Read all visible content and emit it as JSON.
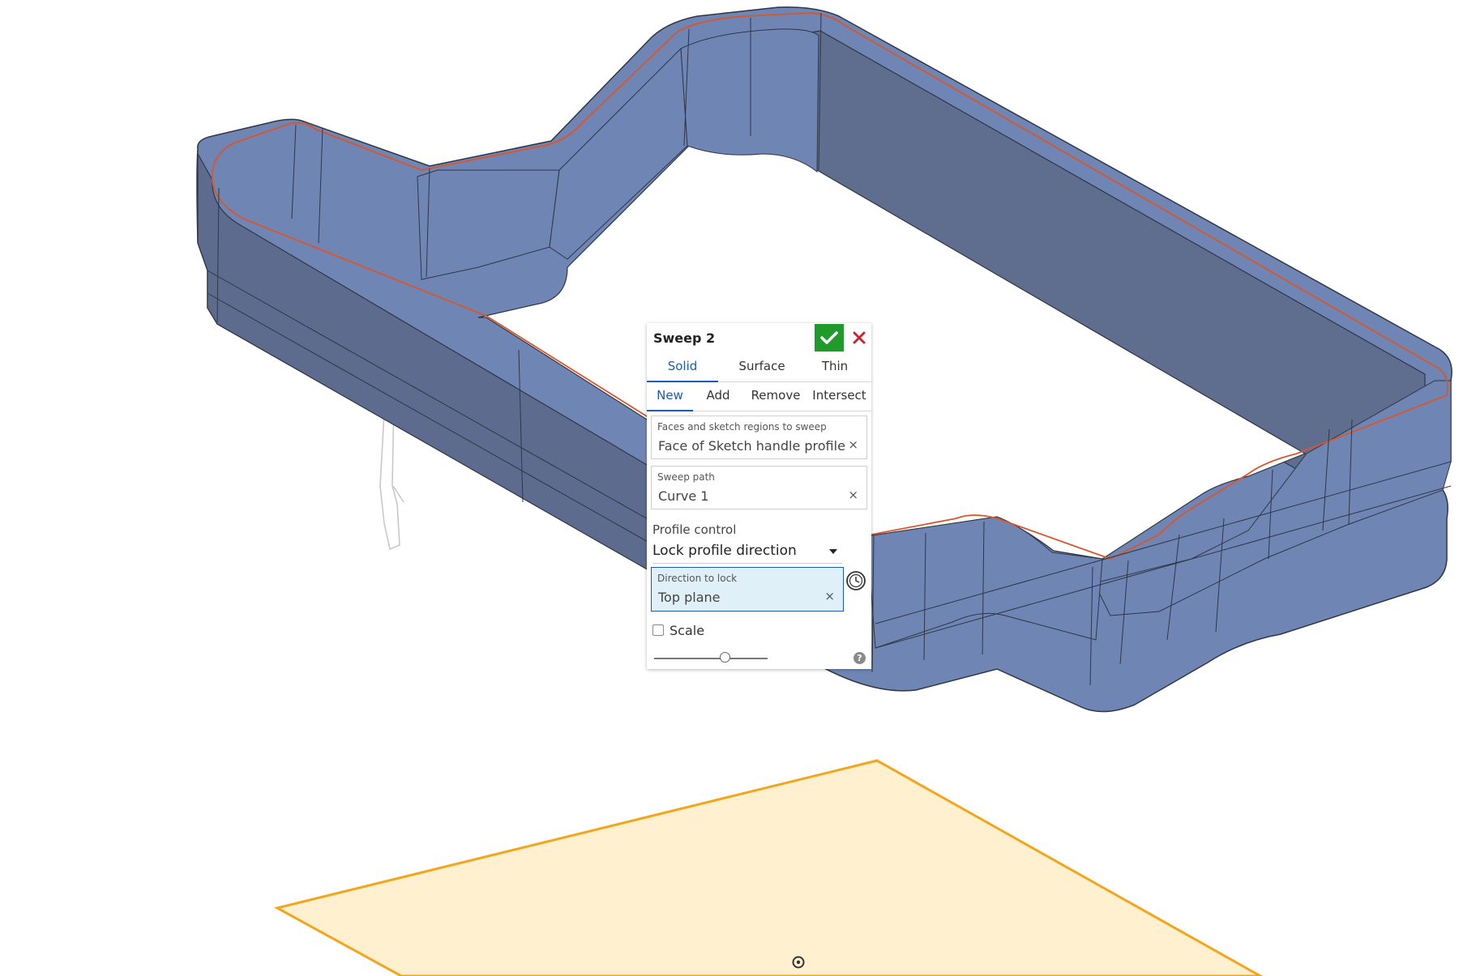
{
  "dialog": {
    "title": "Sweep 2",
    "accept_icon": "check-icon",
    "cancel_icon": "close-icon",
    "body_tabs": [
      "Solid",
      "Surface",
      "Thin"
    ],
    "active_body_tab": "Solid",
    "op_tabs": [
      "New",
      "Add",
      "Remove",
      "Intersect"
    ],
    "active_op_tab": "New",
    "faces_field": {
      "label": "Faces and sketch regions to sweep",
      "value": "Face of Sketch handle profile",
      "clear": "×"
    },
    "path_field": {
      "label": "Sweep path",
      "value": "Curve 1",
      "clear": "×"
    },
    "profile_control": {
      "label": "Profile control",
      "selected": "Lock profile direction"
    },
    "direction_field": {
      "label": "Direction to lock",
      "value": "Top plane",
      "clear": "×"
    },
    "scale": {
      "label": "Scale",
      "checked": false
    },
    "help": "?",
    "slider_value_fraction": 0.62
  },
  "colors": {
    "accent": "#1d5bb0",
    "accept": "#1f9a2b",
    "cancel": "#c8262e",
    "part_face": "#6f86b4",
    "part_face_dark": "#5b6b8f",
    "edge_highlight": "#d9562b",
    "plane_fill": "#fff0cf",
    "plane_edge": "#f3a51c"
  }
}
